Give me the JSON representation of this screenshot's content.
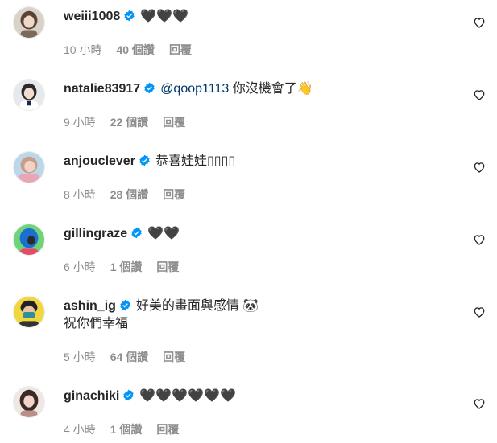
{
  "comments": [
    {
      "username": "weiii1008",
      "mention": "",
      "text": "🖤🖤🖤",
      "text2": "",
      "time": "10 小時",
      "likes": "40 個讚",
      "reply": "回覆",
      "avatar_colors": [
        "#d9d2c8",
        "#5a4336",
        "#f0d8c8"
      ]
    },
    {
      "username": "natalie83917",
      "mention": "@qoop1113",
      "text": " 你沒機會了👋",
      "text2": "",
      "time": "9 小時",
      "likes": "22 個讚",
      "reply": "回覆",
      "avatar_colors": [
        "#e6e8ec",
        "#2b2b2b",
        "#f1dccf"
      ]
    },
    {
      "username": "anjouclever",
      "mention": "",
      "text": "恭喜娃娃▯▯▯▯",
      "text2": "",
      "time": "8 小時",
      "likes": "28 個讚",
      "reply": "回覆",
      "avatar_colors": [
        "#bcd7e8",
        "#c79c8a",
        "#f2d2c6"
      ]
    },
    {
      "username": "gillingraze",
      "mention": "",
      "text": "🖤🖤",
      "text2": "",
      "time": "6 小時",
      "likes": "1 個讚",
      "reply": "回覆",
      "avatar_colors": [
        "#6fd37a",
        "#1a6fd1",
        "#2a2a2a"
      ]
    },
    {
      "username": "ashin_ig",
      "mention": "",
      "text": "好美的畫面與感情 🐼",
      "text2": "祝你們幸福",
      "time": "5 小時",
      "likes": "64 個讚",
      "reply": "回覆",
      "avatar_colors": [
        "#f2d640",
        "#222222",
        "#2f8f9a"
      ]
    },
    {
      "username": "ginachiki",
      "mention": "",
      "text": "🖤🖤🖤🖤🖤🖤",
      "text2": "",
      "time": "4 小時",
      "likes": "1 個讚",
      "reply": "回覆",
      "avatar_colors": [
        "#efe7e2",
        "#3a2a26",
        "#f3d3c9"
      ]
    }
  ],
  "verified_color": "#0095f6"
}
